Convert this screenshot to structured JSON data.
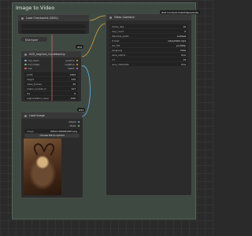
{
  "group": {
    "title": "Image to Video"
  },
  "load_checkpoint": {
    "title": "Load Checkpoint (SDXL)"
  },
  "video_combine": {
    "title": "Video Combine",
    "badge": "#24 ComfyUI-VideoHelperSuite",
    "widgets": [
      {
        "label": "frame_rate",
        "value": "10"
      },
      {
        "label": "loop_count",
        "value": "0"
      },
      {
        "label": "filename_prefix",
        "value": "svd/test"
      },
      {
        "label": "format",
        "value": "video/h264-mp4"
      },
      {
        "label": "pix_fmt",
        "value": "yuv420p"
      },
      {
        "label": "pingpong",
        "value": "false"
      },
      {
        "label": "save_output",
        "value": "true"
      },
      {
        "label": "crf",
        "value": "19"
      },
      {
        "label": "save_metadata",
        "value": "true"
      }
    ]
  },
  "small_node": {
    "label": "KSampler"
  },
  "svd_conditioning": {
    "title": "SVD_img2vid_Conditioning",
    "badge": "#12",
    "outputs": [
      "clip_vision",
      "init_image",
      "vae"
    ],
    "output_labels": [
      "positive",
      "negative",
      "latent"
    ],
    "widgets": [
      {
        "label": "width",
        "value": "1024"
      },
      {
        "label": "height",
        "value": "576"
      },
      {
        "label": "video_frames",
        "value": "25"
      },
      {
        "label": "motion_bucket_id",
        "value": "127"
      },
      {
        "label": "fps",
        "value": "6"
      },
      {
        "label": "augmentation_level",
        "value": "0.00"
      }
    ]
  },
  "load_image": {
    "title": "Load Image",
    "badge": "#23",
    "outputs": [
      "IMAGE",
      "MASK"
    ],
    "widget": {
      "label": "image",
      "value": "00012-3040810467.png"
    },
    "button": "choose file to upload"
  }
}
